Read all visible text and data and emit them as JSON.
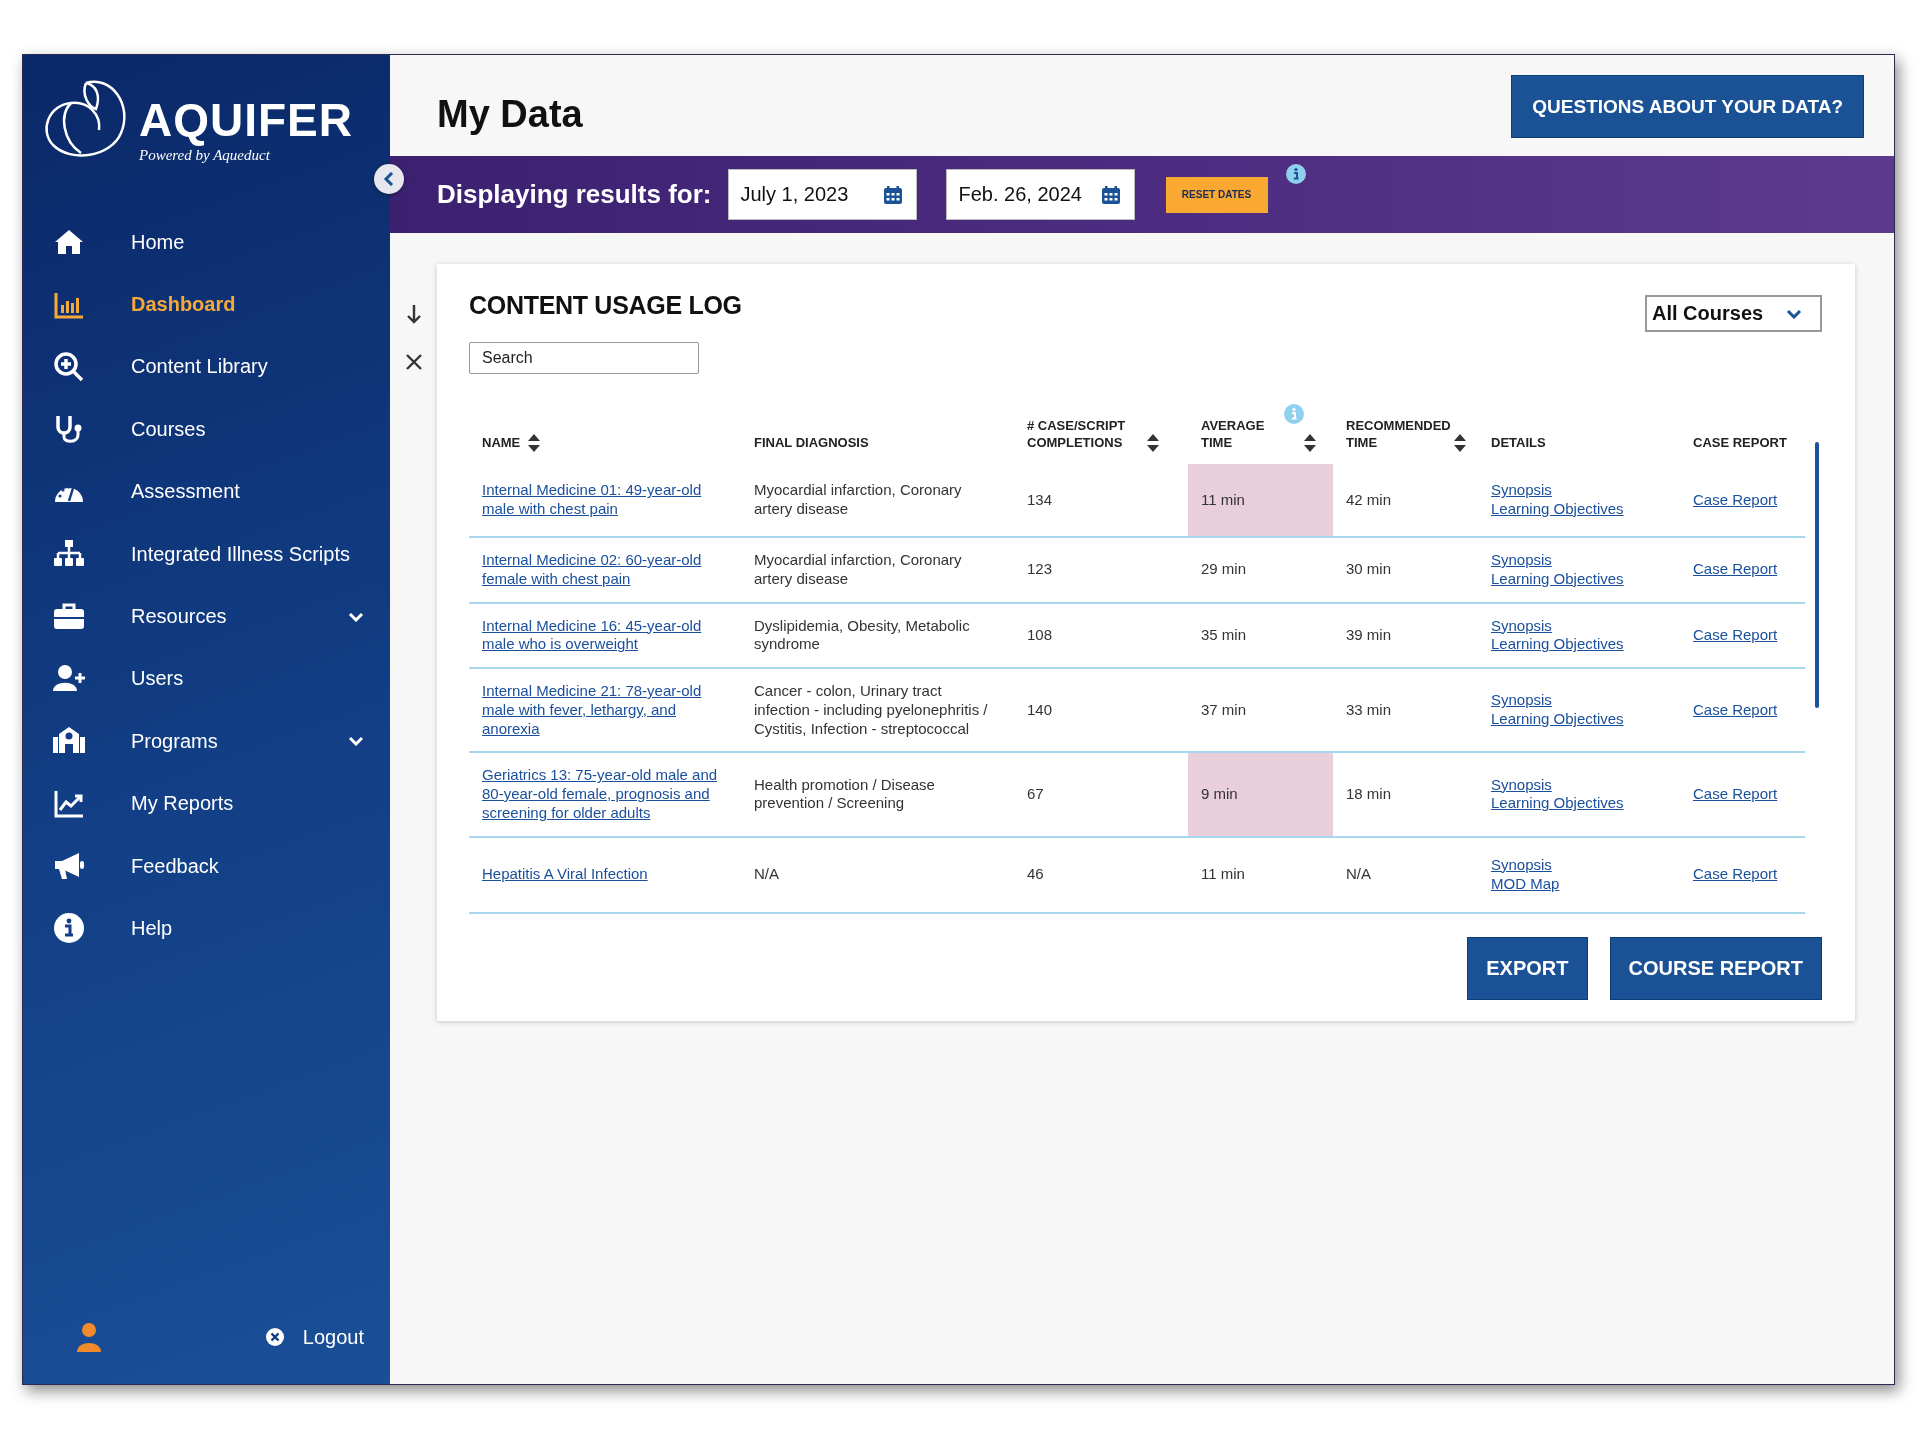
{
  "sidebar": {
    "logo": {
      "wordmark": "AQUIFER",
      "tagline": "Powered by Aqueduct"
    },
    "items": [
      {
        "label": "Home",
        "selected": false,
        "expandable": false
      },
      {
        "label": "Dashboard",
        "selected": true,
        "expandable": false
      },
      {
        "label": "Content Library",
        "selected": false,
        "expandable": false
      },
      {
        "label": "Courses",
        "selected": false,
        "expandable": false
      },
      {
        "label": "Assessment",
        "selected": false,
        "expandable": false
      },
      {
        "label": "Integrated Illness Scripts",
        "selected": false,
        "expandable": false
      },
      {
        "label": "Resources",
        "selected": false,
        "expandable": true
      },
      {
        "label": "Users",
        "selected": false,
        "expandable": false
      },
      {
        "label": "Programs",
        "selected": false,
        "expandable": true
      },
      {
        "label": "My Reports",
        "selected": false,
        "expandable": false
      },
      {
        "label": "Feedback",
        "selected": false,
        "expandable": false
      },
      {
        "label": "Help",
        "selected": false,
        "expandable": false
      }
    ],
    "logout": "Logout"
  },
  "header": {
    "title": "My Data",
    "help_button": "QUESTIONS ABOUT YOUR DATA?"
  },
  "date_bar": {
    "label": "Displaying results for:",
    "start_date": "July 1, 2023",
    "end_date": "Feb. 26, 2024",
    "reset_button": "RESET DATES"
  },
  "content_usage_log": {
    "title": "CONTENT USAGE LOG",
    "course_filter": "All Courses",
    "search": {
      "placeholder": "Search"
    },
    "columns": [
      {
        "label": "NAME",
        "sortable": true,
        "info": false
      },
      {
        "label": "FINAL DIAGNOSIS",
        "sortable": false,
        "info": false
      },
      {
        "label": "# CASE/SCRIPT COMPLETIONS",
        "sortable": true,
        "info": false
      },
      {
        "label": "AVERAGE TIME",
        "sortable": true,
        "info": true
      },
      {
        "label": "RECOMMENDED TIME",
        "sortable": true,
        "info": false
      },
      {
        "label": "DETAILS",
        "sortable": false,
        "info": false
      },
      {
        "label": "CASE REPORT",
        "sortable": false,
        "info": false
      }
    ],
    "rows": [
      {
        "name": "Internal Medicine 01: 49-year-old male with chest pain",
        "diagnosis": "Myocardial infarction, Coronary artery disease",
        "completions": "134",
        "average_time": "11 min",
        "highlighted": true,
        "recommended_time": "42 min",
        "details": [
          "Synopsis",
          "Learning Objectives"
        ],
        "case_report": "Case Report"
      },
      {
        "name": "Internal Medicine 02: 60-year-old female with chest pain",
        "diagnosis": "Myocardial infarction, Coronary artery disease",
        "completions": "123",
        "average_time": "29 min",
        "highlighted": false,
        "recommended_time": "30 min",
        "details": [
          "Synopsis",
          "Learning Objectives"
        ],
        "case_report": "Case Report"
      },
      {
        "name": "Internal Medicine 16: 45-year-old male who is overweight",
        "diagnosis": "Dyslipidemia, Obesity, Metabolic syndrome",
        "completions": "108",
        "average_time": "35 min",
        "highlighted": false,
        "recommended_time": "39 min",
        "details": [
          "Synopsis",
          "Learning Objectives"
        ],
        "case_report": "Case Report"
      },
      {
        "name": "Internal Medicine 21: 78-year-old male with fever, lethargy, and anorexia",
        "diagnosis": "Cancer - colon, Urinary tract infection - including pyelonephritis / Cystitis, Infection - streptococcal",
        "completions": "140",
        "average_time": "37 min",
        "highlighted": false,
        "recommended_time": "33 min",
        "details": [
          "Synopsis",
          "Learning Objectives"
        ],
        "case_report": "Case Report"
      },
      {
        "name": "Geriatrics 13: 75-year-old male and 80-year-old female, prognosis and screening for older adults",
        "diagnosis": "Health promotion / Disease prevention / Screening",
        "completions": "67",
        "average_time": "9 min",
        "highlighted": true,
        "recommended_time": "18 min",
        "details": [
          "Synopsis",
          "Learning Objectives"
        ],
        "case_report": "Case Report"
      },
      {
        "name": "Hepatitis A Viral Infection",
        "diagnosis": "N/A",
        "completions": "46",
        "average_time": "11 min",
        "highlighted": false,
        "recommended_time": "N/A",
        "details": [
          "Synopsis",
          "MOD Map"
        ],
        "case_report": "Case Report"
      }
    ],
    "buttons": [
      "EXPORT",
      "COURSE REPORT"
    ]
  }
}
